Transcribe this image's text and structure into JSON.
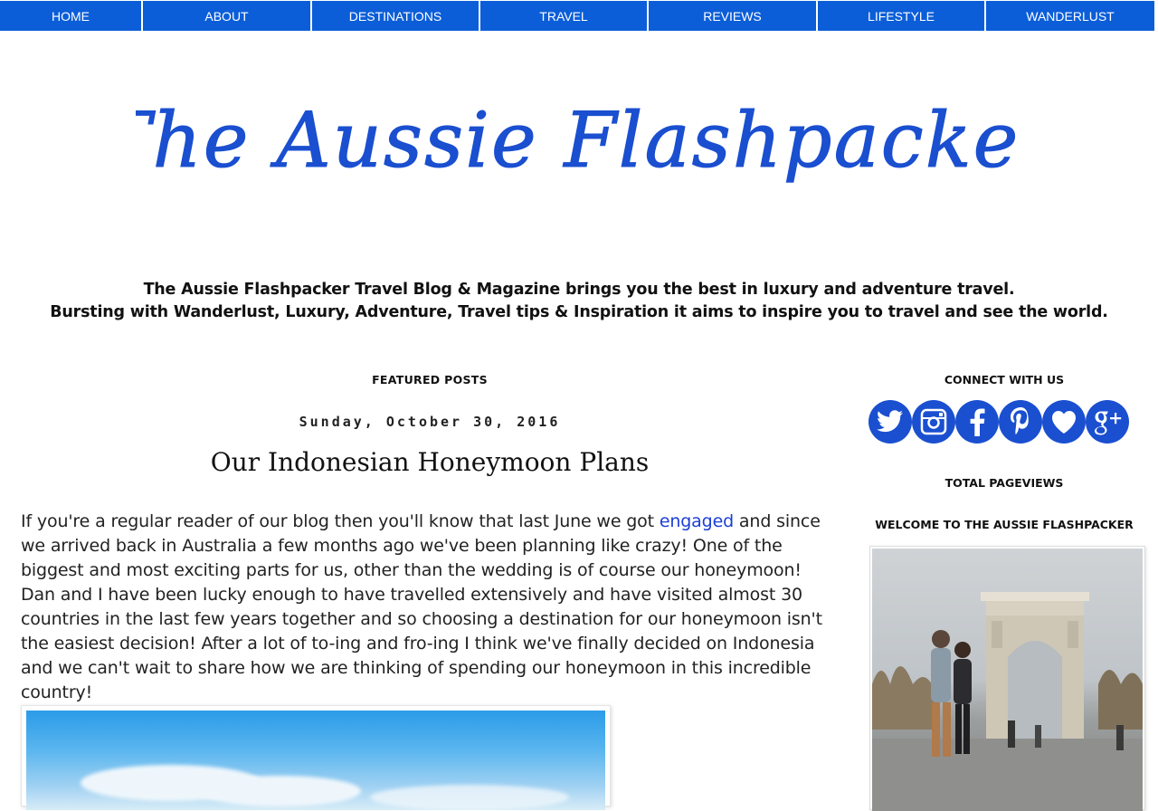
{
  "nav": {
    "items": [
      {
        "label": "HOME"
      },
      {
        "label": "ABOUT"
      },
      {
        "label": "DESTINATIONS"
      },
      {
        "label": "TRAVEL"
      },
      {
        "label": "REVIEWS"
      },
      {
        "label": "LIFESTYLE"
      },
      {
        "label": "WANDERLUST"
      }
    ]
  },
  "header": {
    "logo_text": "The Aussie Flashpacker",
    "tagline_line1": "The Aussie Flashpacker Travel Blog & Magazine brings you the best in luxury and adventure travel.",
    "tagline_line2": "Bursting with Wanderlust, Luxury, Adventure, Travel tips & Inspiration it aims to inspire you to travel and see the world."
  },
  "main": {
    "section_heading": "FEATURED POSTS",
    "post": {
      "date": "Sunday, October 30, 2016",
      "title": "Our Indonesian Honeymoon Plans",
      "body_before_link": "If you're a regular reader of our blog then you'll know that last June we got ",
      "link_text": "engaged",
      "body_after_link": " and since we arrived back in Australia a few months ago we've been planning like crazy! One of the biggest and most exciting parts for us, other than the wedding is of course our honeymoon! Dan and I have been lucky enough to have travelled extensively and have visited almost 30 countries in the last few years together and so choosing a destination for our honeymoon isn't the easiest decision! After a lot of to-ing and fro-ing I think we've finally decided on Indonesia and we can't wait to share how we are thinking of spending our honeymoon in this incredible country!"
    }
  },
  "sidebar": {
    "connect_heading": "CONNECT WITH US",
    "social_icons": [
      "twitter-icon",
      "instagram-icon",
      "facebook-icon",
      "pinterest-icon",
      "bloglovin-icon",
      "google-plus-icon"
    ],
    "pageviews_heading": "TOTAL PAGEVIEWS",
    "welcome_heading": "WELCOME TO THE AUSSIE FLASHPACKER"
  },
  "colors": {
    "nav_bg": "#0b5ed8",
    "brand_blue": "#1a4fd0",
    "link": "#1a3fd6"
  }
}
